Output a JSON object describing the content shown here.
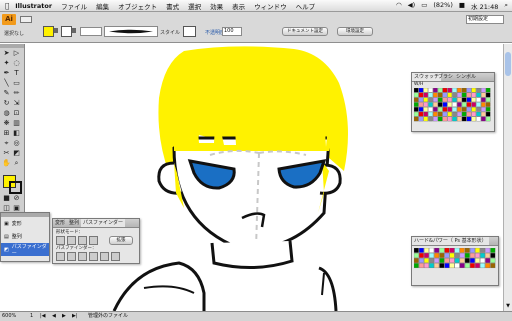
{
  "menubar": {
    "apple": "",
    "app_name": "Illustrator",
    "items": [
      "ファイル",
      "編集",
      "オブジェクト",
      "書式",
      "選択",
      "効果",
      "表示",
      "ウィンドウ",
      "ヘルプ"
    ],
    "battery": "(82%)",
    "clock": "水 21:48"
  },
  "control": {
    "logo": "Ai",
    "label_left": "選択なし",
    "workspace_label": "初期設定",
    "style_label": "スタイル",
    "opacity_label": "不透明度",
    "opacity_value": "100",
    "doc_setup_button": "ドキュメント設定",
    "prefs_button": "環境設定"
  },
  "swatches_panel": {
    "tabs": [
      "スウォッチ",
      "ブラシ",
      "シンボル"
    ],
    "row_label": "W/H"
  },
  "brush_panel": {
    "tabs": [
      "ハード&パワー（ Ps 基本形状）"
    ]
  },
  "pathfinder_panel": {
    "tabs": [
      "変形",
      "整列",
      "パスファインダー"
    ],
    "shape_mode_label": "形状モード：",
    "pathfinder_label": "パスファインダー：",
    "expand_button": "拡張"
  },
  "collapsed_panels": {
    "items": [
      "変形",
      "整列",
      "パスファインダー"
    ]
  },
  "status": {
    "zoom": "600%",
    "page": "1",
    "info": "管理外のファイル"
  },
  "colors": {
    "hair": "#ffeb00",
    "eyes": "#1a6fc4",
    "fill": "#fff200",
    "accent": "#f29a1a"
  }
}
